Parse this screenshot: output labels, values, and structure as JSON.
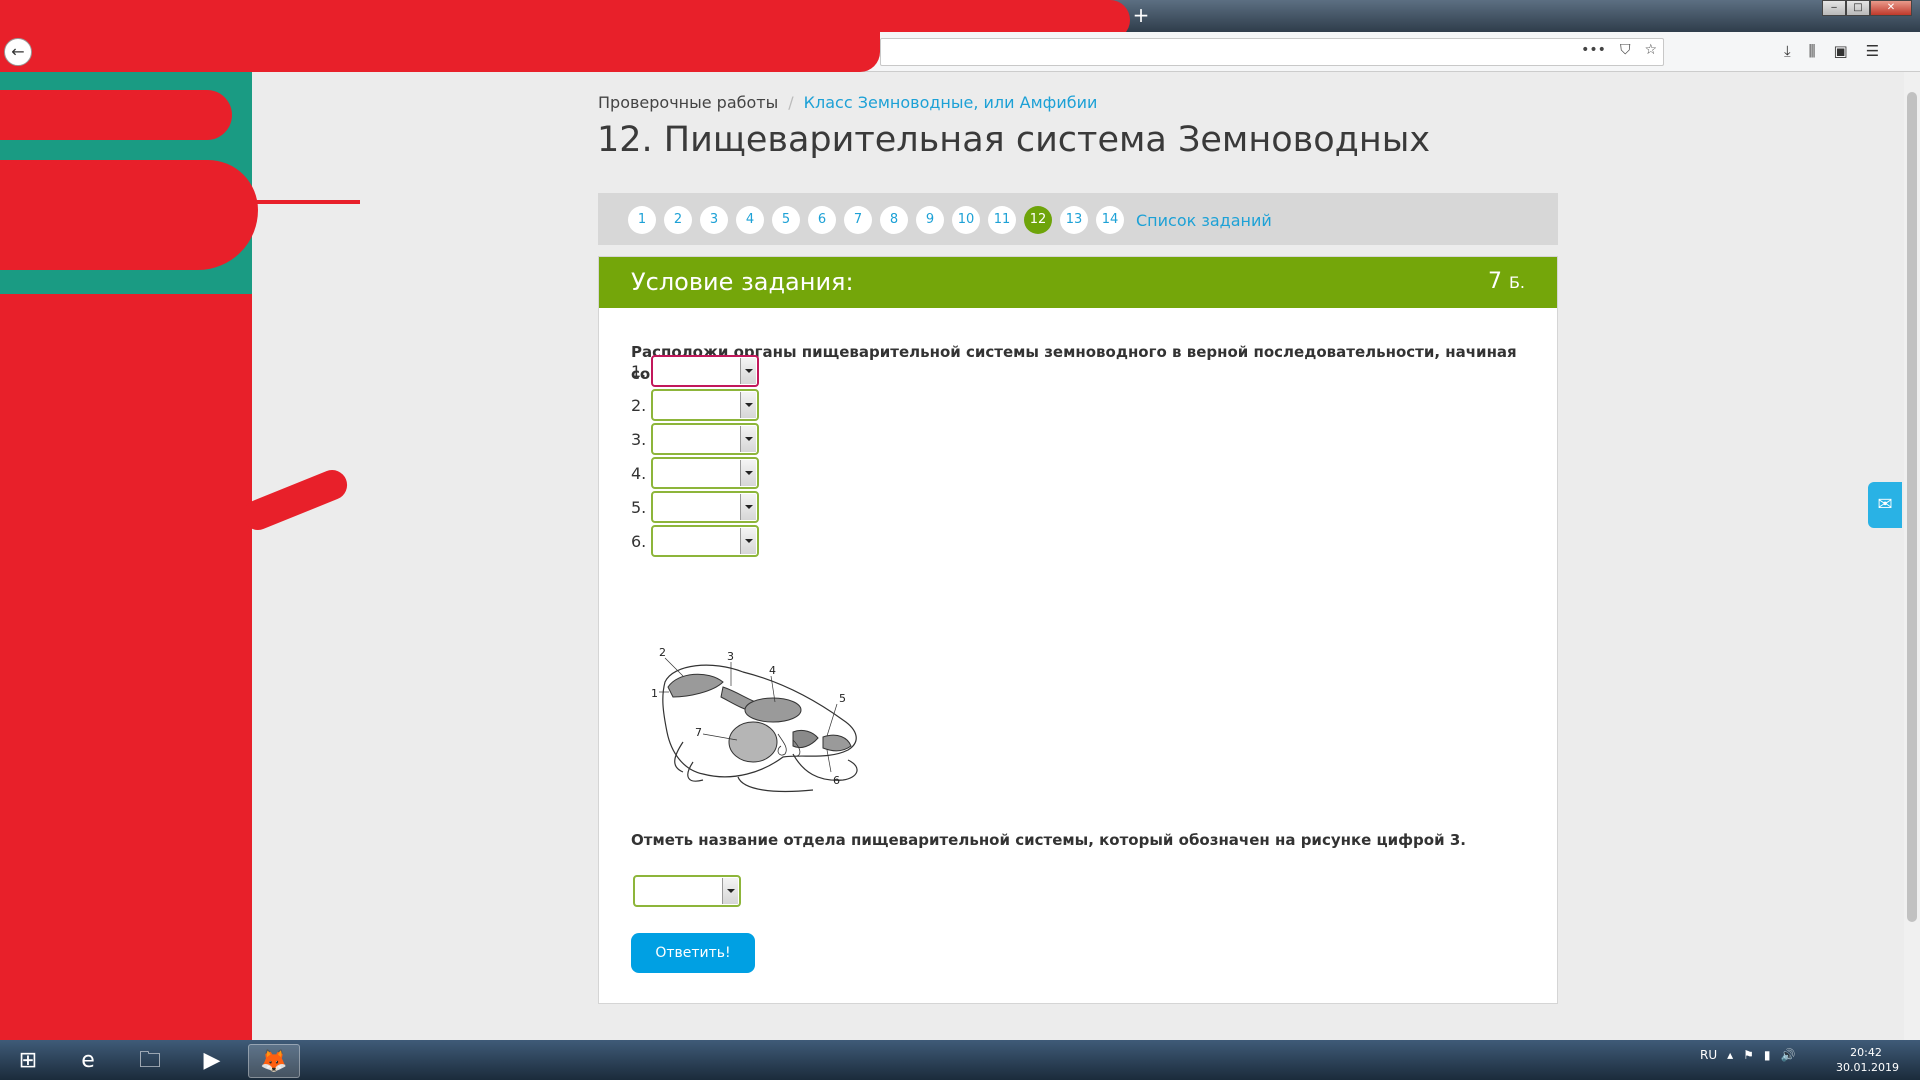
{
  "browser": {
    "new_tab": "+",
    "win_minimize": "‒",
    "win_maximize": "□",
    "win_close": "✕",
    "back": "←",
    "url_icons": [
      "•••",
      "⛉",
      "☆"
    ],
    "toolbar_icons": [
      "⤓",
      "⫼",
      "▣",
      "☰"
    ]
  },
  "breadcrumb": {
    "root": "Проверочные работы",
    "separator": "/",
    "current": "Класс Земноводные, или Амфибии"
  },
  "page_title": "12. Пищеварительная система Земноводных",
  "pager": {
    "pages": [
      "1",
      "2",
      "3",
      "4",
      "5",
      "6",
      "7",
      "8",
      "9",
      "10",
      "11",
      "12",
      "13",
      "14"
    ],
    "active": "12",
    "list_label": "Список заданий"
  },
  "task": {
    "header": "Условие задания:",
    "points_value": "7",
    "points_unit": "Б.",
    "question": "Расположи органы пищеварительной системы земноводного в верной последовательности, начиная со рта.:",
    "select_numbers": [
      "1.",
      "2.",
      "3.",
      "4.",
      "5.",
      "6."
    ],
    "figure_labels": [
      "1",
      "2",
      "3",
      "4",
      "5",
      "6",
      "7"
    ],
    "question2": "Отметь название отдела пищеварительной системы, который обозначен на рисунке цифрой 3.",
    "answer_button": "Ответить!"
  },
  "feedback_icon": "✉",
  "taskbar": {
    "items": [
      "⊞",
      "e",
      "🗀",
      "▶",
      "🦊"
    ],
    "lang": "RU",
    "tray": [
      "▴",
      "⚑",
      "▮",
      "🔊"
    ],
    "time": "20:42",
    "date": "30.01.2019"
  }
}
